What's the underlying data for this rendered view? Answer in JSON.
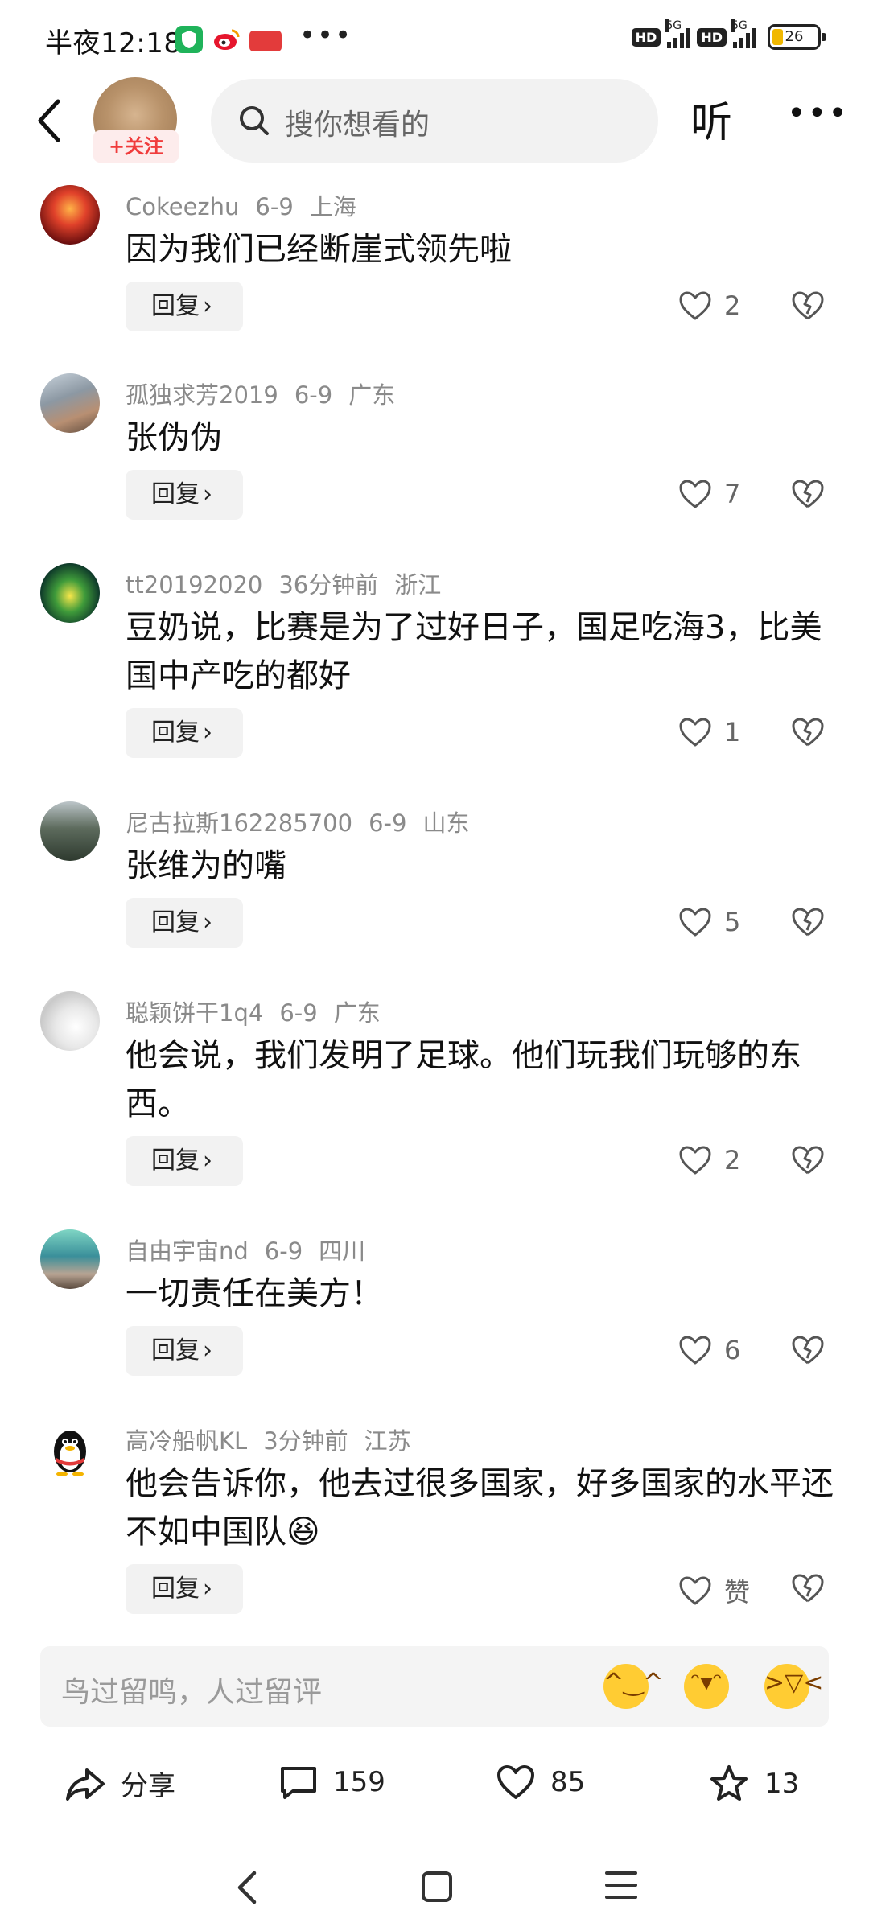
{
  "status_bar": {
    "time": "半夜12:18",
    "app_badges": [
      "qq-security-icon",
      "weibo-icon",
      "toutiao-icon"
    ],
    "more": "•••",
    "network_1": "5G",
    "network_2": "5G",
    "battery": "26"
  },
  "header": {
    "follow_label": "+关注",
    "search_placeholder": "搜你想看的",
    "listen_label": "听",
    "more_label": "•••"
  },
  "comments": [
    {
      "user": "Cokeezhu",
      "date": "6-9",
      "region": "上海",
      "text": "因为我们已经断崖式领先啦",
      "likes": "2",
      "reply_label": "回复"
    },
    {
      "user": "孤独求芳2019",
      "date": "6-9",
      "region": "广东",
      "text": "张伪伪",
      "likes": "7",
      "reply_label": "回复"
    },
    {
      "user": "tt20192020",
      "date": "36分钟前",
      "region": "浙江",
      "text": "豆奶说，比赛是为了过好日子，国足吃海3，比美国中产吃的都好",
      "likes": "1",
      "reply_label": "回复"
    },
    {
      "user": "尼古拉斯162285700",
      "date": "6-9",
      "region": "山东",
      "text": "张维为的嘴",
      "likes": "5",
      "reply_label": "回复"
    },
    {
      "user": "聪颖饼干1q4",
      "date": "6-9",
      "region": "广东",
      "text": "他会说，我们发明了足球。他们玩我们玩够的东西。",
      "likes": "2",
      "reply_label": "回复"
    },
    {
      "user": "自由宇宙nd",
      "date": "6-9",
      "region": "四川",
      "text": "一切责任在美方！",
      "likes": "6",
      "reply_label": "回复"
    },
    {
      "user": "高冷船帆KL",
      "date": "3分钟前",
      "region": "江苏",
      "text": "他会告诉你，他去过很多国家，好多国家的水平还不如中国队😆",
      "likes": "赞",
      "reply_label": "回复"
    }
  ],
  "input": {
    "placeholder": "鸟过留鸣，人过留评",
    "emojis": [
      "laughing-emoji",
      "grinning-emoji",
      "rolling-laughing-emoji"
    ]
  },
  "actions": {
    "share_label": "分享",
    "comments_count": "159",
    "likes_count": "85",
    "favorites_count": "13"
  },
  "colors": {
    "accent_red": "#f03c3c",
    "muted_text": "#8a8a8a",
    "pill_bg": "#f2f2f2"
  }
}
